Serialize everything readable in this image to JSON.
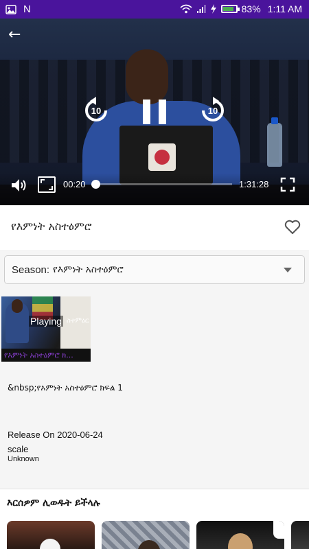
{
  "status_bar": {
    "time": "1:11 AM",
    "battery_percent": "83%",
    "battery_level": 0.83,
    "left_icons": [
      "image-icon",
      "n-notification-icon"
    ],
    "right_icons": [
      "wifi-icon",
      "signal-icon",
      "charging-bolt-icon",
      "battery-icon"
    ],
    "notification_letter": "N"
  },
  "player": {
    "current_time": "00:20",
    "total_time": "1:31:28",
    "progress": 0.004,
    "rewind_seconds": "10",
    "forward_seconds": "10",
    "state": "playing"
  },
  "title": "የእምነት አስተዕምሮ",
  "season": {
    "label": "Season:",
    "value": "የእምነት አስተዕምሮ"
  },
  "episode_card": {
    "overlay": "Playing",
    "overlay_sub": "ስተምዕር",
    "caption": "የእምነት አስተዕምሮ ክ..."
  },
  "description": "&nbsp;የእምነት አስተዕምሮ ክፍል 1",
  "release": "Release On 2020-06-24",
  "scale_label": "scale",
  "scale_value": "Unknown",
  "recommendations": {
    "title": "እርሰዎም ሊወዱት ይችላሉ"
  },
  "colors": {
    "status_bar": "#4a149c",
    "caption_accent": "#8a3fd2"
  }
}
